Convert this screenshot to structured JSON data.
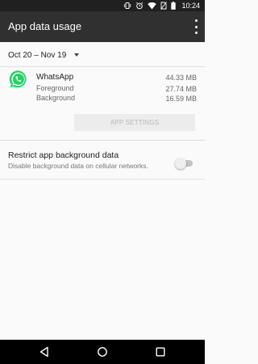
{
  "status_bar": {
    "time": "10:24"
  },
  "app_bar": {
    "title": "App data usage",
    "overflow_icon": "more-vert-icon"
  },
  "date_range": {
    "label": "Oct 20 – Nov 19"
  },
  "app": {
    "name": "WhatsApp",
    "icon": "whatsapp-icon",
    "total": "44.33 MB",
    "foreground_label": "Foreground",
    "foreground_value": "27.74 MB",
    "background_label": "Background",
    "background_value": "16.59 MB",
    "settings_button": "APP SETTINGS"
  },
  "restrict": {
    "title": "Restrict app background data",
    "subtitle": "Disable background data on cellular networks.",
    "enabled": false
  },
  "nav_bar": {
    "back_icon": "back-icon",
    "home_icon": "home-icon",
    "recents_icon": "recents-icon"
  },
  "colors": {
    "status_bar": "#202020",
    "app_bar": "#303030",
    "whatsapp_green": "#25D366",
    "background": "#fafafa"
  }
}
